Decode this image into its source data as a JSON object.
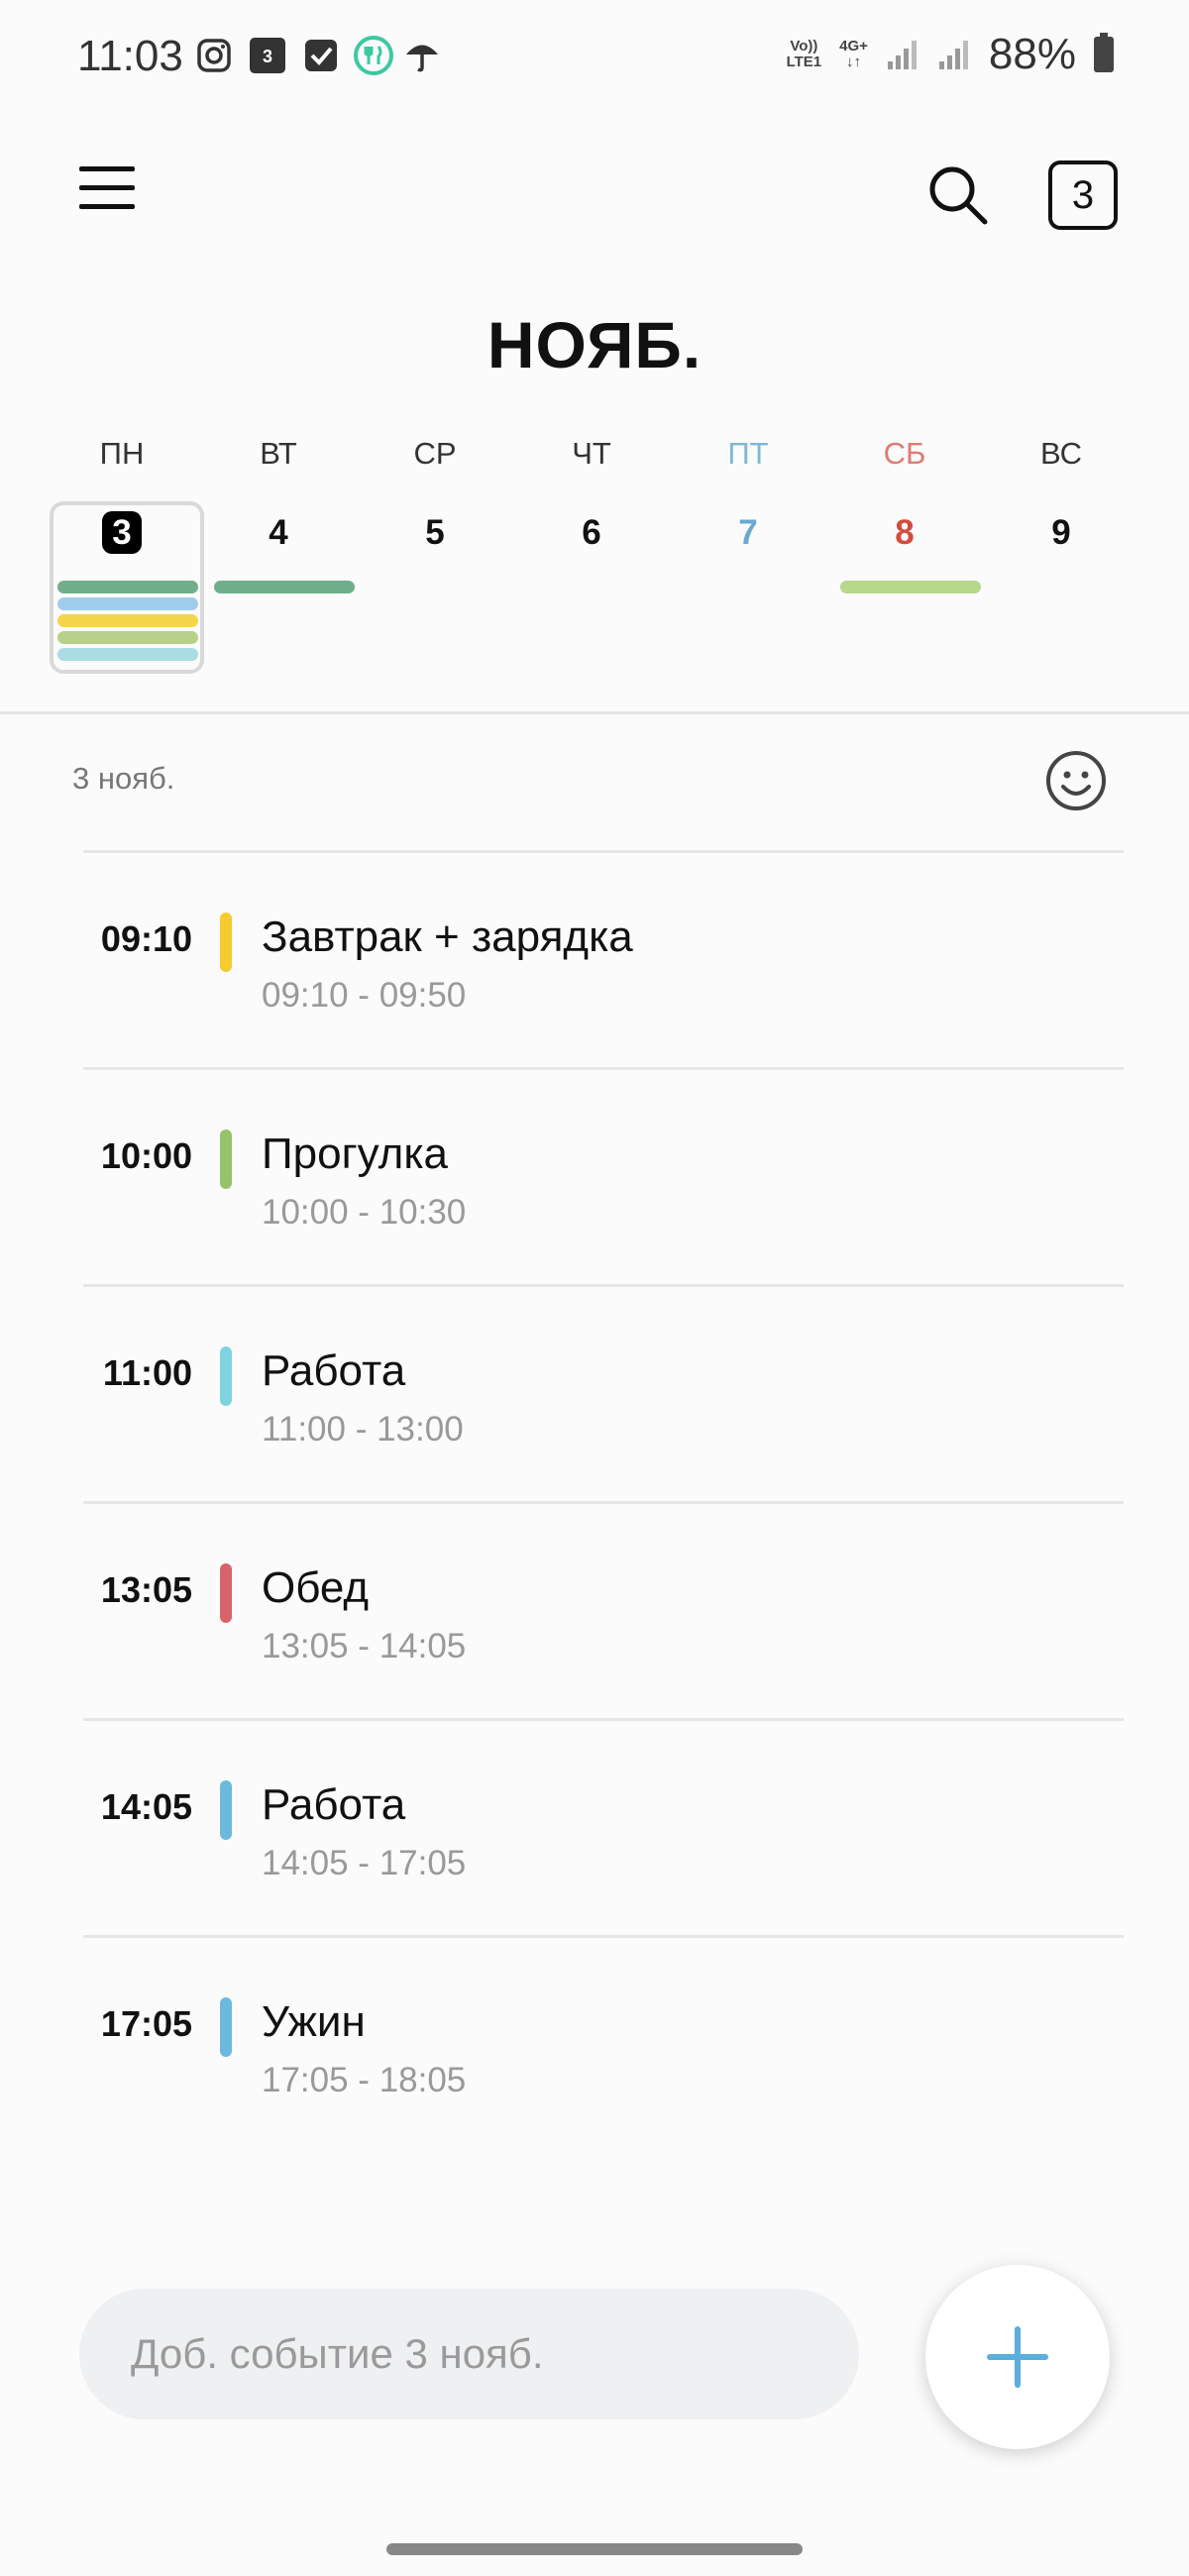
{
  "status_bar": {
    "time": "11:03",
    "calendar_badge": "3",
    "network_top": "Vo))",
    "network_bottom": "LTE1",
    "network_type": "4G+",
    "battery": "88%"
  },
  "header": {
    "today_badge": "3",
    "month": "НОЯБ."
  },
  "week": {
    "days": [
      {
        "name": "ПН",
        "number": "3",
        "name_color": "#333333",
        "num_color": "#111111",
        "bars": [
          "#6fb08a",
          "#9fcdeb",
          "#f5d54a",
          "#b8d189",
          "#a9dde3"
        ]
      },
      {
        "name": "ВТ",
        "number": "4",
        "name_color": "#333333",
        "num_color": "#111111",
        "bars": [
          "#6fb08a"
        ]
      },
      {
        "name": "СР",
        "number": "5",
        "name_color": "#333333",
        "num_color": "#111111",
        "bars": []
      },
      {
        "name": "ЧТ",
        "number": "6",
        "name_color": "#333333",
        "num_color": "#111111",
        "bars": []
      },
      {
        "name": "ПТ",
        "number": "7",
        "name_color": "#7fb7d6",
        "num_color": "#6aa9cf",
        "bars": []
      },
      {
        "name": "СБ",
        "number": "8",
        "name_color": "#e07a72",
        "num_color": "#d64a3e",
        "bars": [
          "#b5d88a"
        ]
      },
      {
        "name": "ВС",
        "number": "9",
        "name_color": "#333333",
        "num_color": "#111111",
        "bars": []
      }
    ]
  },
  "agenda": {
    "date_label": "3 нояб.",
    "events": [
      {
        "time": "09:10",
        "title": "Завтрак + зарядка",
        "range": "09:10 - 09:50",
        "color": "#f5cc2e"
      },
      {
        "time": "10:00",
        "title": "Прогулка",
        "range": "10:00 - 10:30",
        "color": "#95c26a"
      },
      {
        "time": "11:00",
        "title": "Работа",
        "range": "11:00 - 13:00",
        "color": "#7fd3df"
      },
      {
        "time": "13:05",
        "title": "Обед",
        "range": "13:05 - 14:05",
        "color": "#d9636a"
      },
      {
        "time": "14:05",
        "title": "Работа",
        "range": "14:05 - 17:05",
        "color": "#6cb9e0"
      },
      {
        "time": "17:05",
        "title": "Ужин",
        "range": "17:05 - 18:05",
        "color": "#6cb9e0"
      }
    ]
  },
  "bottom": {
    "add_placeholder": "Доб. событие 3 нояб."
  },
  "icons": {
    "menu": "menu-icon",
    "search": "search-icon",
    "smile": "smile-icon",
    "add": "plus-icon"
  }
}
